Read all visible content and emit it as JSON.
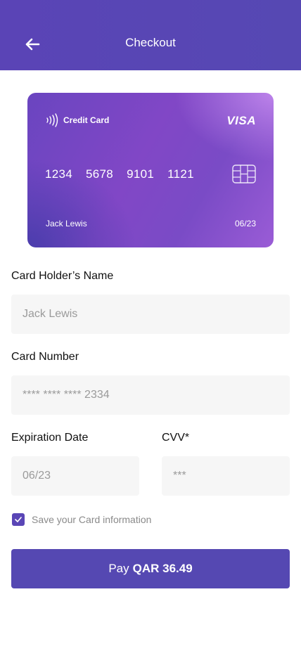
{
  "header": {
    "title": "Checkout",
    "back_icon": "arrow-left-icon",
    "background": "#5a44b6"
  },
  "card": {
    "type_label": "Credit Card",
    "brand": "VISA",
    "number_groups": [
      "1234",
      "5678",
      "9101",
      "1121"
    ],
    "holder": "Jack Lewis",
    "expiry": "06/23",
    "icons": [
      "contactless-icon",
      "chip-icon"
    ]
  },
  "form": {
    "holder_label": "Card Holder’s Name",
    "holder_placeholder": "Jack Lewis",
    "number_label": "Card Number",
    "number_placeholder": "**** **** **** 2334",
    "expiry_label": "Expiration Date",
    "expiry_placeholder": "06/23",
    "cvv_label": "CVV*",
    "cvv_placeholder": "***",
    "save_label": "Save your Card information",
    "save_checked": true
  },
  "pay": {
    "prefix": "Pay",
    "amount": "QAR 36.49"
  },
  "colors": {
    "accent": "#5548b2",
    "input_bg": "#f6f6f6"
  }
}
